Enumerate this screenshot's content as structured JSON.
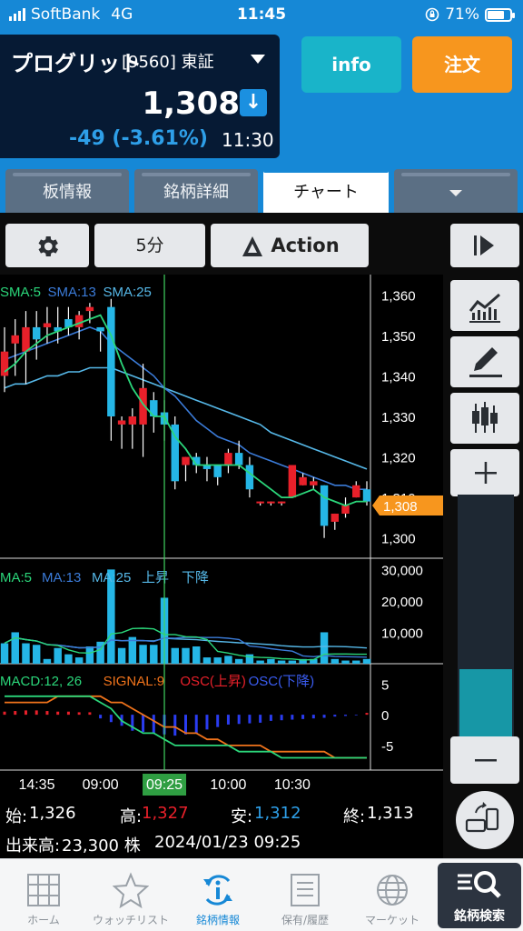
{
  "status": {
    "carrier": "SoftBank",
    "network": "4G",
    "time": "11:45",
    "battery": "71%"
  },
  "stock": {
    "name": "プログリット",
    "code": "[9560] 東証",
    "price": "1,308",
    "change": "-49 (-3.61%)",
    "time": "11:30",
    "info_label": "info",
    "order_label": "注文"
  },
  "tabs": [
    "板情報",
    "銘柄詳細",
    "チャート"
  ],
  "toolbar": {
    "interval": "5分",
    "action": "Action"
  },
  "chart_data": {
    "type": "candlestick",
    "price_axis": {
      "ticks": [
        "1,360",
        "1,350",
        "1,340",
        "1,330",
        "1,320",
        "1,310",
        "1,300"
      ],
      "min": 1295,
      "max": 1365
    },
    "current_price_label": "1,308",
    "ma_legend": [
      "SMA:5",
      "SMA:13",
      "SMA:25"
    ],
    "volume_legend": [
      "MA:5",
      "MA:13",
      "MA:25",
      "上昇",
      "下降"
    ],
    "volume_axis": [
      "30,000",
      "20,000",
      "10,000"
    ],
    "macd_legend": [
      "MACD:12, 26",
      "SIGNAL:9",
      "OSC(上昇)",
      "OSC(下降)"
    ],
    "macd_axis": [
      "5",
      "0",
      "-5"
    ],
    "time_axis": [
      "14:35",
      "09:00",
      "09:25",
      "10:00",
      "10:30"
    ],
    "cursor_label": "09:25",
    "candles": [
      {
        "o": 1340,
        "h": 1352,
        "l": 1336,
        "c": 1346
      },
      {
        "o": 1348,
        "h": 1354,
        "l": 1340,
        "c": 1350
      },
      {
        "o": 1346,
        "h": 1356,
        "l": 1338,
        "c": 1352
      },
      {
        "o": 1352,
        "h": 1356,
        "l": 1344,
        "c": 1349
      },
      {
        "o": 1352,
        "h": 1357,
        "l": 1348,
        "c": 1353
      },
      {
        "o": 1352,
        "h": 1357,
        "l": 1348,
        "c": 1351
      },
      {
        "o": 1354,
        "h": 1357,
        "l": 1350,
        "c": 1352
      },
      {
        "o": 1352,
        "h": 1356,
        "l": 1349,
        "c": 1355
      },
      {
        "o": 1356,
        "h": 1358,
        "l": 1353,
        "c": 1357
      },
      {
        "o": 1352,
        "h": 1352,
        "l": 1346,
        "c": 1351
      },
      {
        "o": 1357,
        "h": 1359,
        "l": 1324,
        "c": 1330
      },
      {
        "o": 1328,
        "h": 1330,
        "l": 1322,
        "c": 1329
      },
      {
        "o": 1328,
        "h": 1332,
        "l": 1322,
        "c": 1330
      },
      {
        "o": 1328,
        "h": 1343,
        "l": 1320,
        "c": 1337
      },
      {
        "o": 1334,
        "h": 1336,
        "l": 1326,
        "c": 1330
      },
      {
        "o": 1331,
        "h": 1334,
        "l": 1324,
        "c": 1328
      },
      {
        "o": 1328,
        "h": 1330,
        "l": 1312,
        "c": 1314
      },
      {
        "o": 1318,
        "h": 1320,
        "l": 1314,
        "c": 1320
      },
      {
        "o": 1320,
        "h": 1321,
        "l": 1316,
        "c": 1318
      },
      {
        "o": 1318,
        "h": 1320,
        "l": 1314,
        "c": 1317
      },
      {
        "o": 1318,
        "h": 1318,
        "l": 1313,
        "c": 1315
      },
      {
        "o": 1318,
        "h": 1322,
        "l": 1316,
        "c": 1321
      },
      {
        "o": 1321,
        "h": 1324,
        "l": 1317,
        "c": 1318
      },
      {
        "o": 1318,
        "h": 1320,
        "l": 1310,
        "c": 1312
      },
      {
        "o": 1309,
        "h": 1309,
        "l": 1308,
        "c": 1309
      },
      {
        "o": 1309,
        "h": 1309,
        "l": 1308,
        "c": 1309
      },
      {
        "o": 1309,
        "h": 1309,
        "l": 1308,
        "c": 1309
      },
      {
        "o": 1310,
        "h": 1318,
        "l": 1310,
        "c": 1318
      },
      {
        "o": 1313,
        "h": 1316,
        "l": 1313,
        "c": 1315
      },
      {
        "o": 1313,
        "h": 1315,
        "l": 1312,
        "c": 1314
      },
      {
        "o": 1313,
        "h": 1313,
        "l": 1300,
        "c": 1303
      },
      {
        "o": 1304,
        "h": 1306,
        "l": 1302,
        "c": 1306
      },
      {
        "o": 1306,
        "h": 1310,
        "l": 1305,
        "c": 1308
      },
      {
        "o": 1310,
        "h": 1314,
        "l": 1310,
        "c": 1313
      },
      {
        "o": 1312,
        "h": 1314,
        "l": 1308,
        "c": 1309
      }
    ],
    "sma5": [
      1341,
      1343,
      1346,
      1348,
      1350,
      1351,
      1352,
      1353,
      1354,
      1355,
      1350,
      1343,
      1337,
      1333,
      1330,
      1330,
      1325,
      1322,
      1318,
      1318,
      1318,
      1318,
      1318,
      1316,
      1314,
      1312,
      1310,
      1310,
      1311,
      1312,
      1310,
      1309,
      1308,
      1309,
      1309
    ],
    "sma13": [
      1344,
      1345,
      1346,
      1347,
      1348,
      1349,
      1350,
      1351,
      1352,
      1351,
      1348,
      1346,
      1344,
      1342,
      1340,
      1337,
      1335,
      1332,
      1329,
      1327,
      1325,
      1324,
      1323,
      1321,
      1320,
      1319,
      1318,
      1317,
      1316,
      1315,
      1314,
      1313,
      1313,
      1312,
      1312
    ],
    "sma25": [
      1337,
      1338,
      1338,
      1339,
      1340,
      1340,
      1341,
      1341,
      1342,
      1342,
      1342,
      1341,
      1340,
      1339,
      1338,
      1337,
      1336,
      1335,
      1334,
      1333,
      1332,
      1331,
      1330,
      1329,
      1328,
      1326,
      1325,
      1324,
      1323,
      1322,
      1321,
      1320,
      1319,
      1318,
      1317
    ],
    "volume": [
      6500,
      10000,
      6500,
      6000,
      1500,
      5000,
      3000,
      2000,
      5500,
      7000,
      30000,
      5000,
      8500,
      6000,
      6000,
      21000,
      5000,
      5000,
      5500,
      2000,
      2000,
      2500,
      1500,
      3000,
      1000,
      1500,
      1000,
      1000,
      1500,
      1500,
      10000,
      1500,
      1000,
      1000,
      1500
    ],
    "macd": [
      3,
      3,
      3,
      3,
      3,
      3,
      3,
      3,
      3,
      2,
      1,
      -1,
      -2,
      -3,
      -3,
      -4,
      -5,
      -5,
      -5,
      -5,
      -5,
      -5,
      -6,
      -6,
      -6,
      -6,
      -7,
      -7,
      -7,
      -7,
      -7,
      -7,
      -7,
      -7,
      -7
    ],
    "signal": [
      2,
      2,
      2,
      2,
      2,
      3,
      3,
      3,
      3,
      3,
      2,
      2,
      1,
      0,
      -1,
      -2,
      -2,
      -3,
      -3,
      -4,
      -4,
      -5,
      -5,
      -5,
      -5,
      -6,
      -6,
      -6,
      -6,
      -6,
      -6,
      -7,
      -7,
      -7,
      -7
    ],
    "osc": [
      0.5,
      0.6,
      0.7,
      0.7,
      0.6,
      0.5,
      0.5,
      0.4,
      0.4,
      -0.6,
      -1.2,
      -1.8,
      -2.6,
      -2.8,
      -3.0,
      -3.2,
      -3.4,
      -3.2,
      -3.0,
      -2.4,
      -2.0,
      -1.6,
      -1.5,
      -1.4,
      -1.3,
      -1.0,
      -0.9,
      -0.8,
      -0.7,
      -0.6,
      -0.5,
      -0.3,
      -0.2,
      -0.1,
      0.3
    ]
  },
  "ohlc": {
    "open_label": "始:",
    "open": "1,326",
    "high_label": "高:",
    "high": "1,327",
    "low_label": "安:",
    "low": "1,312",
    "close_label": "終:",
    "close": "1,313",
    "volume_label": "出来高:",
    "volume": "23,300 株",
    "datetime": "2024/01/23 09:25"
  },
  "nav": [
    "ホーム",
    "ウォッチリスト",
    "銘柄情報",
    "保有/履歴",
    "マーケット",
    "銘柄検索"
  ],
  "colors": {
    "up": "#e8202a",
    "down": "#25b6e6",
    "sma5": "#2bd67a",
    "sma13": "#3b7bd8",
    "sma25": "#56b8e8",
    "signal": "#f0731b",
    "cursor": "#3fd25f",
    "accent": "#1688d6"
  }
}
